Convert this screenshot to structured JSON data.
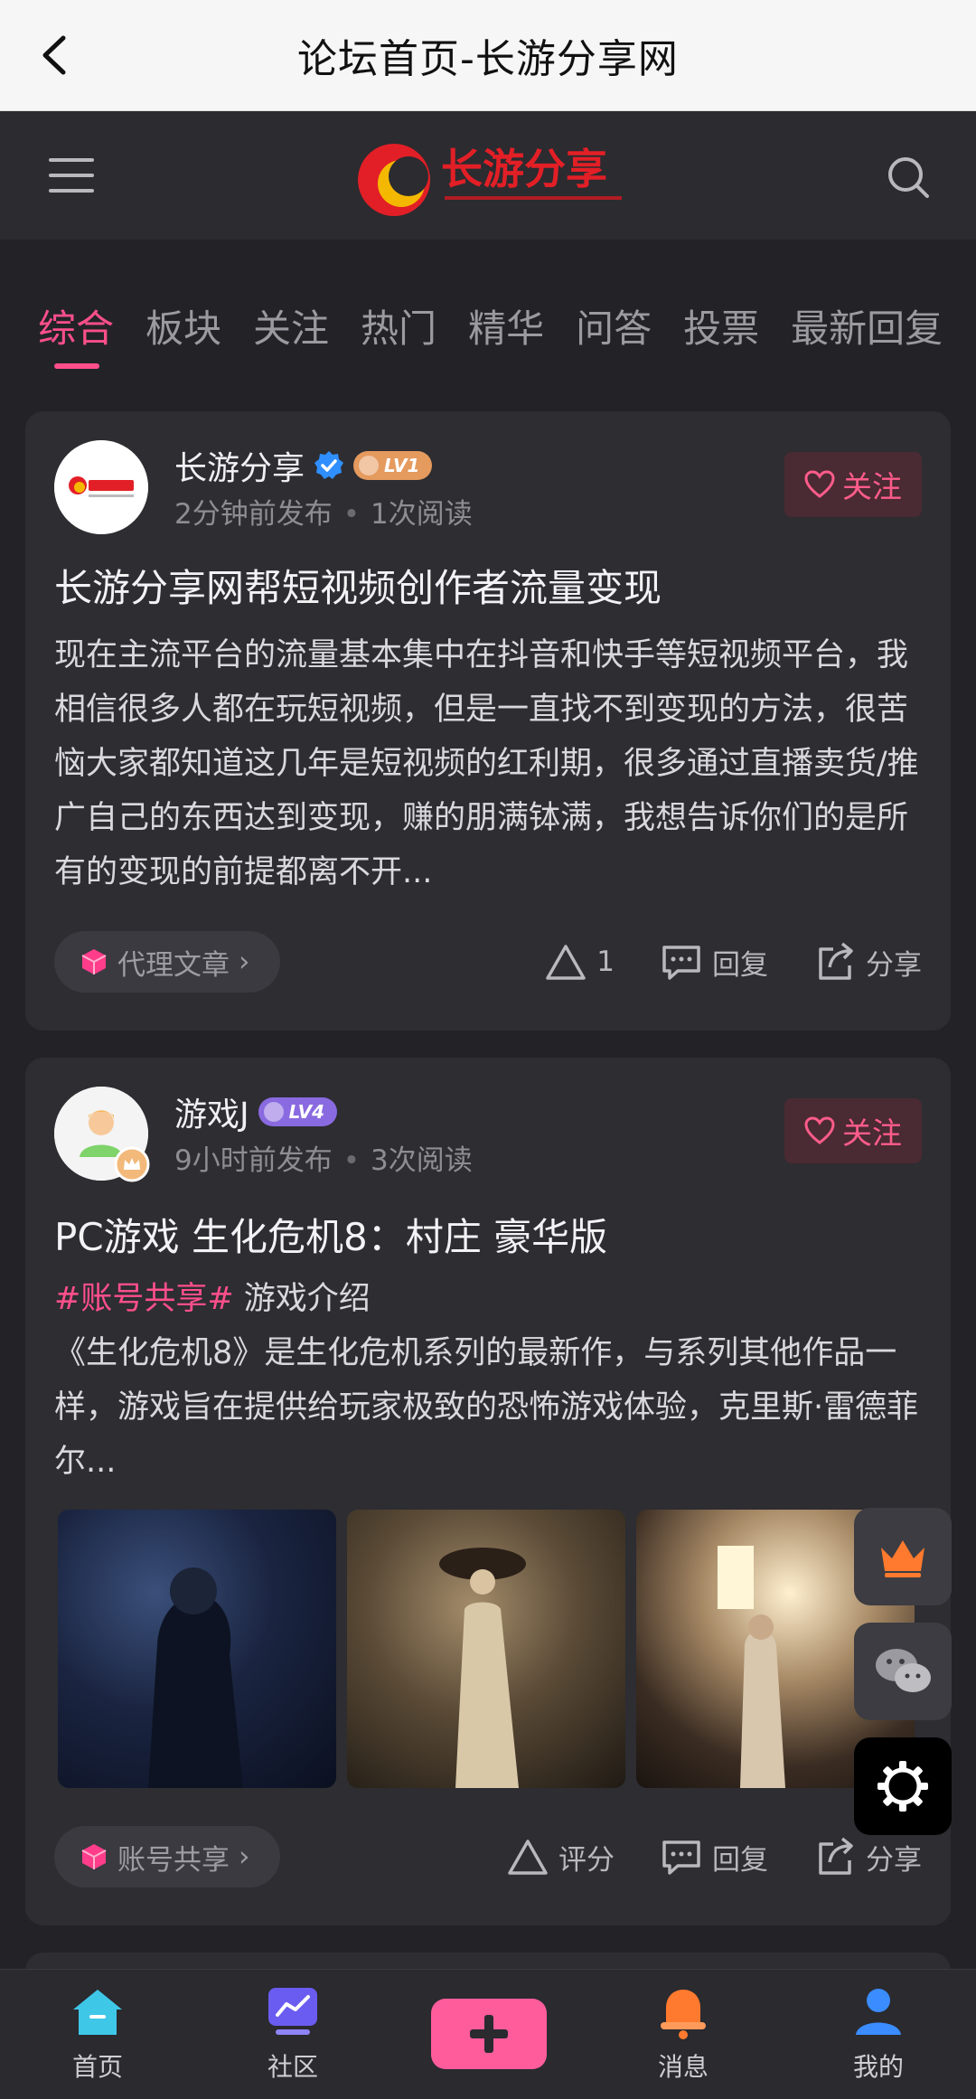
{
  "titlebar": {
    "title": "论坛首页-长游分享网"
  },
  "header": {
    "logo_text": "长游分享"
  },
  "tabs": [
    "综合",
    "板块",
    "关注",
    "热门",
    "精华",
    "问答",
    "投票",
    "最新回复"
  ],
  "posts": [
    {
      "author": "长游分享",
      "level": "LV1",
      "time": "2分钟前发布",
      "reads": "1次阅读",
      "follow_label": "关注",
      "title": "长游分享网帮短视频创作者流量变现",
      "body": "现在主流平台的流量基本集中在抖音和快手等短视频平台，我相信很多人都在玩短视频，但是一直找不到变现的方法，很苦恼大家都知道这几年是短视频的红利期，很多通过直播卖货/推广自己的东西达到变现，赚的朋满钵满，我想告诉你们的是所有的变现的前提都离不开...",
      "tag": "代理文章",
      "likes": "1",
      "reply_label": "回复",
      "share_label": "分享"
    },
    {
      "author": "游戏J",
      "level": "LV4",
      "time": "9小时前发布",
      "reads": "3次阅读",
      "follow_label": "关注",
      "title": "PC游戏 生化危机8：村庄 豪华版",
      "hashtag": "#账号共享#",
      "subtitle": "游戏介绍",
      "body": "《生化危机8》是生化危机系列的最新作，与系列其他作品一样，游戏旨在提供给玩家极致的恐怖游戏体验，克里斯·雷德菲尔...",
      "tag": "账号共享",
      "rate_label": "评分",
      "reply_label": "回复",
      "share_label": "分享"
    }
  ],
  "bottom_nav": {
    "home": "首页",
    "community": "社区",
    "messages": "消息",
    "mine": "我的"
  },
  "colors": {
    "accent": "#ff4f8a",
    "background": "#232327",
    "card": "#2d2d32"
  }
}
